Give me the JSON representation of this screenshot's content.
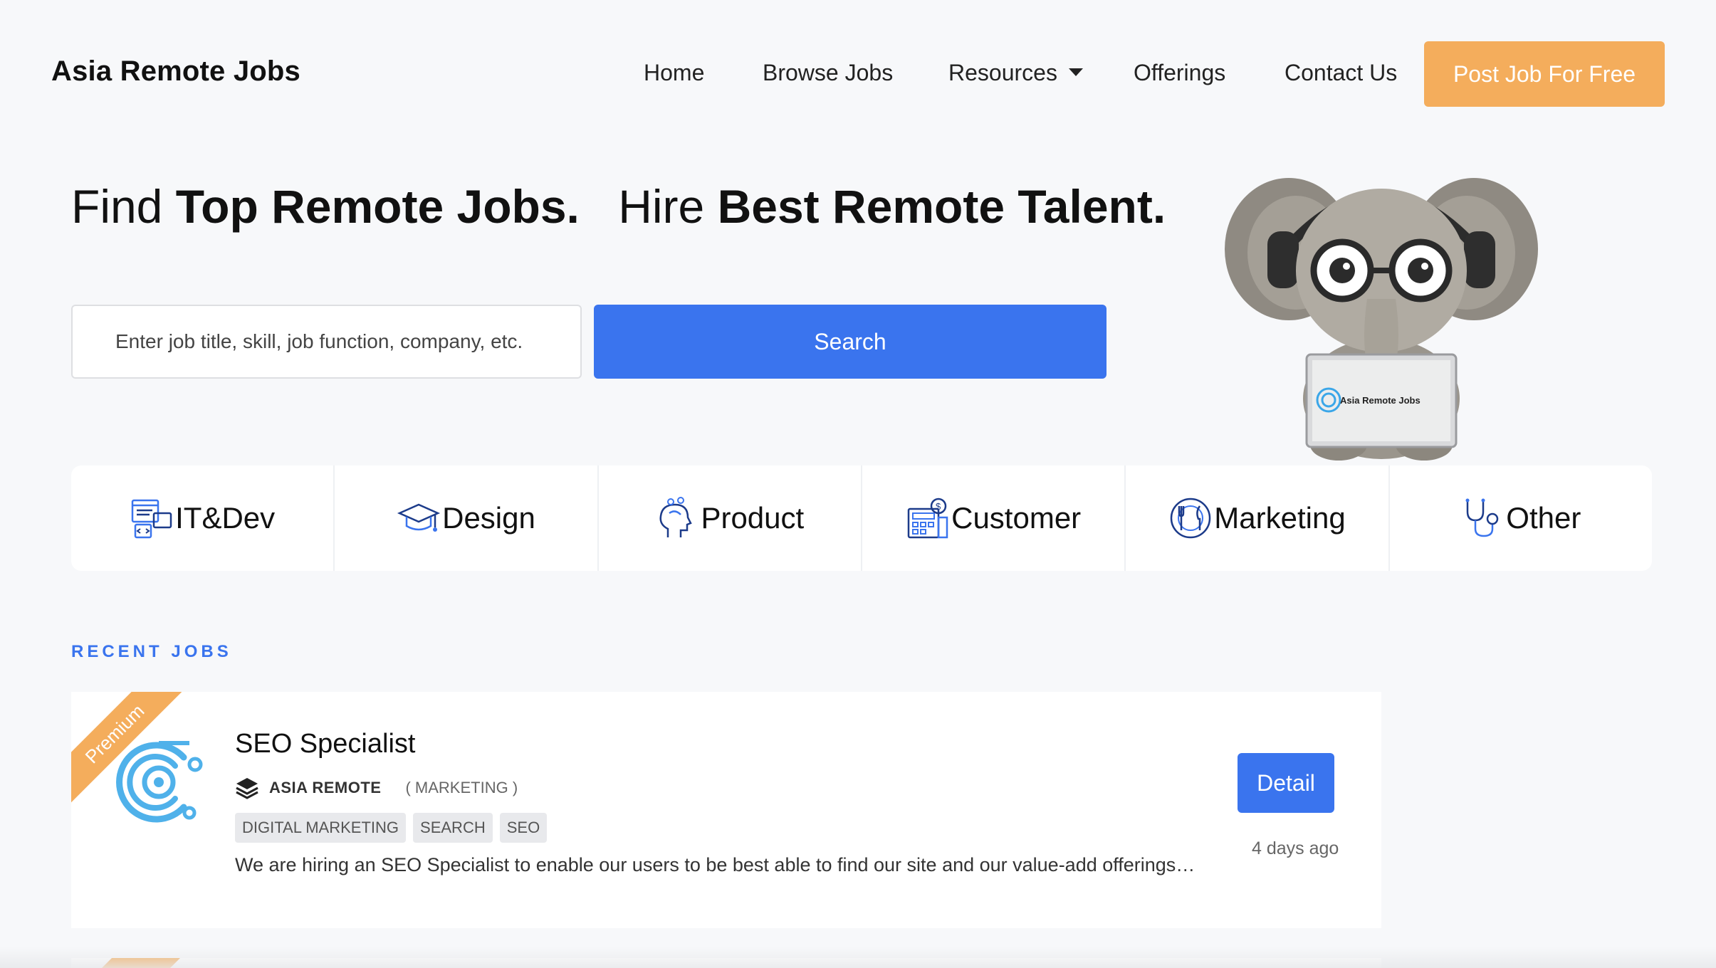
{
  "nav": {
    "brand": "Asia Remote Jobs",
    "items": [
      "Home",
      "Browse Jobs",
      "Resources",
      "Offerings",
      "Contact Us"
    ],
    "post_button": "Post Job For Free"
  },
  "hero": {
    "find": "Find",
    "find_bold": "Top Remote Jobs.",
    "hire": "Hire",
    "hire_bold": "Best Remote Talent.",
    "search_placeholder": "Enter job title, skill, job function, company, etc.",
    "search_button": "Search",
    "mascot_laptop_text": "Asia Remote Jobs"
  },
  "categories": [
    {
      "label": "IT&Dev",
      "icon": "it-dev-icon"
    },
    {
      "label": "Design",
      "icon": "graduation-cap-icon"
    },
    {
      "label": "Product",
      "icon": "head-ideas-icon"
    },
    {
      "label": "Customer",
      "icon": "register-icon"
    },
    {
      "label": "Marketing",
      "icon": "plate-cutlery-icon"
    },
    {
      "label": "Other",
      "icon": "stethoscope-icon"
    }
  ],
  "recent": {
    "label": "RECENT JOBS",
    "jobs": [
      {
        "ribbon": "Premium",
        "title": "SEO Specialist",
        "company": "ASIA REMOTE",
        "category": "( MARKETING )",
        "tags": [
          "DIGITAL MARKETING",
          "SEARCH",
          "SEO"
        ],
        "description": "We are hiring an SEO Specialist to enable our users to be best able to find our site and our value-add offerings…",
        "detail_button": "Detail",
        "age": "4 days ago"
      }
    ]
  },
  "colors": {
    "accent_blue": "#3a74ee",
    "accent_orange": "#f4ad5c",
    "background": "#f7f8fa"
  }
}
